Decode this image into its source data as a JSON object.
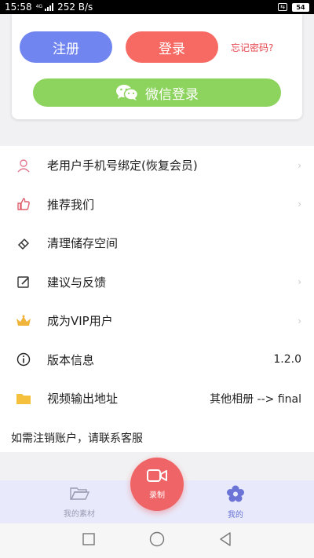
{
  "status": {
    "time": "15:58",
    "network": "4G",
    "speed": "252 B/s",
    "battery": "54"
  },
  "login": {
    "register_label": "注册",
    "login_label": "登录",
    "forgot_label": "忘记密码?",
    "wechat_label": "微信登录"
  },
  "menu": [
    {
      "icon": "user-icon",
      "label": "老用户手机号绑定(恢复会员)",
      "value": ""
    },
    {
      "icon": "thumbs-up-icon",
      "label": "推荐我们",
      "value": ""
    },
    {
      "icon": "eraser-icon",
      "label": "清理储存空间",
      "value": ""
    },
    {
      "icon": "edit-icon",
      "label": "建议与反馈",
      "value": ""
    },
    {
      "icon": "crown-icon",
      "label": "成为VIP用户",
      "value": ""
    },
    {
      "icon": "info-icon",
      "label": "版本信息",
      "value": "1.2.0"
    },
    {
      "icon": "folder-icon",
      "label": "视频输出地址",
      "value": "其他相册 --> final"
    }
  ],
  "note": "如需注销账户，请联系客服",
  "tabs": {
    "materials_label": "我的素材",
    "record_label": "录制",
    "mine_label": "我的"
  },
  "colors": {
    "register": "#7185f0",
    "login": "#f66a63",
    "wechat": "#8dd45e",
    "record": "#ef6466",
    "tab_active": "#6b74d6"
  }
}
